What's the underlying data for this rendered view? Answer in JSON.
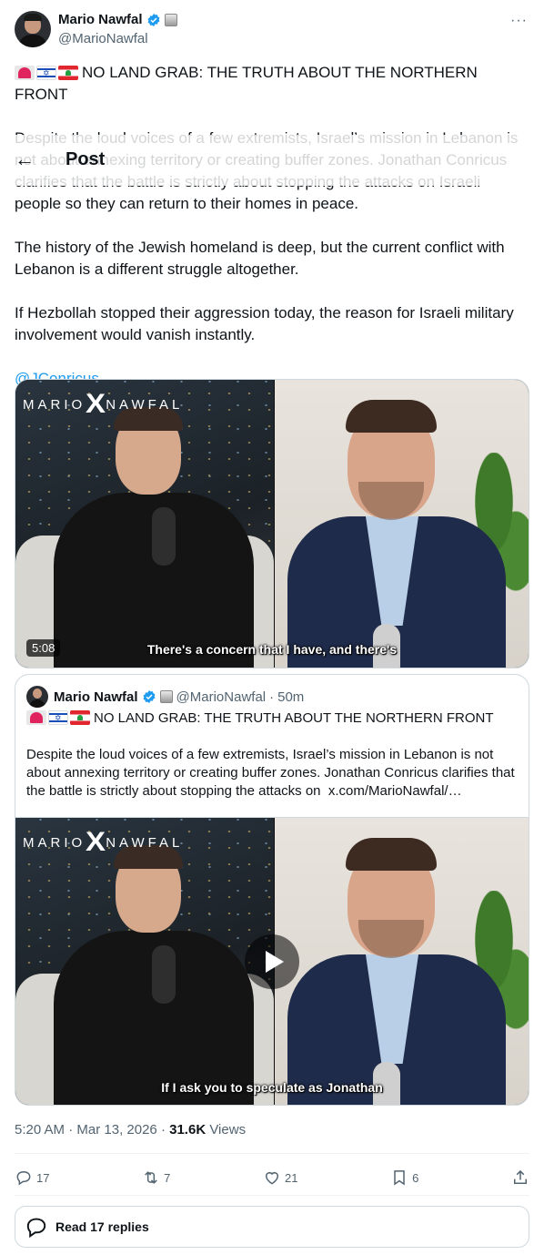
{
  "author": {
    "name": "Mario Nawfal",
    "handle": "@MarioNawfal"
  },
  "nav": {
    "back_icon": "←",
    "title": "Post"
  },
  "tweet": {
    "headline": "NO LAND GRAB: THE TRUTH ABOUT THE NORTHERN FRONT",
    "paragraph1": "Despite the loud voices of a few extremists, Israel’s mission in Lebanon is not about annexing territory or creating buffer zones. Jonathan Conricus clarifies that the battle is strictly about stopping the attacks on Israeli people so they can return to their homes in peace.",
    "paragraph2": "The history of the Jewish homeland is deep, but the current conflict with Lebanon is a different struggle altogether.",
    "paragraph3": "If Hezbollah stopped their aggression today, the reason for Israeli military involvement would vanish instantly.",
    "mention": "@JConricus"
  },
  "video": {
    "brand_left": "MARIO",
    "brand_x": "X",
    "brand_right": "NAWFAL",
    "caption": "There's a concern that I have, and there's",
    "duration": "5:08"
  },
  "quote": {
    "name": "Mario Nawfal",
    "handle": "@MarioNawfal",
    "separator": "·",
    "time": "50m",
    "headline": "NO LAND GRAB: THE TRUTH ABOUT THE NORTHERN FRONT",
    "text": "Despite the loud voices of a few extremists, Israel’s mission in Lebanon is not about annexing territory or creating buffer zones. Jonathan Conricus clarifies that the battle is strictly about stopping the attacks on",
    "link": "x.com/MarioNawfal/…",
    "caption": "If I ask you to speculate as Jonathan"
  },
  "meta": {
    "time": "5:20 AM",
    "date": "Mar 13, 2026",
    "separator": "·",
    "views_count": "31.6K",
    "views_label": "Views"
  },
  "actions": {
    "replies": "17",
    "reposts": "7",
    "likes": "21",
    "bookmarks": "6"
  },
  "read_replies": "Read 17 replies",
  "colors": {
    "accent": "#1d9bf0",
    "secondary_text": "#536471",
    "border": "#cfd9de"
  },
  "icons": [
    "more-icon",
    "verified-icon",
    "affiliate-badge-icon",
    "back-arrow-icon",
    "siren-icon",
    "israel-flag-icon",
    "lebanon-flag-icon",
    "play-icon",
    "reply-icon",
    "repost-icon",
    "like-icon",
    "bookmark-icon",
    "share-icon",
    "reply-bubble-icon"
  ]
}
